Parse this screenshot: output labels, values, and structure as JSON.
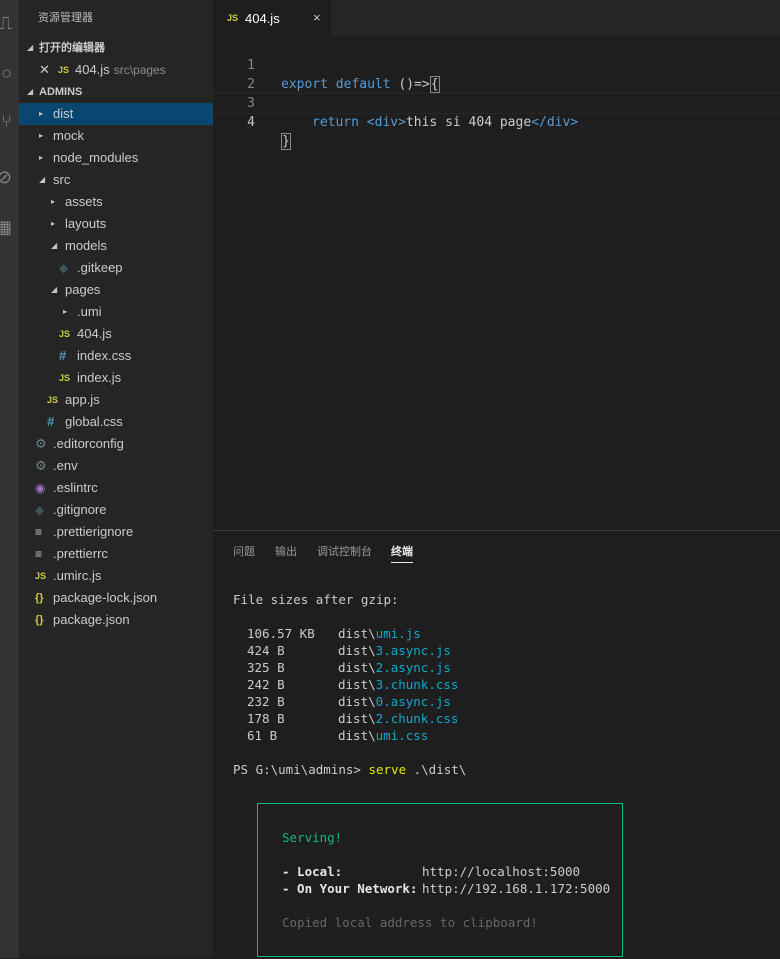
{
  "explorer": {
    "title": "资源管理器",
    "open_editors_label": "打开的编辑器",
    "open_editor": {
      "icon": "JS",
      "name": "404.js",
      "path": "src\\pages"
    },
    "project_label": "ADMINS",
    "tree": [
      {
        "label": "dist",
        "icon": "",
        "twisty": "▸",
        "selected": true
      },
      {
        "label": "mock",
        "icon": "",
        "twisty": "▸"
      },
      {
        "label": "node_modules",
        "icon": "",
        "twisty": "▸"
      },
      {
        "label": "src",
        "icon": "",
        "twisty": "◢"
      },
      {
        "label": "assets",
        "icon": "",
        "twisty": "▸"
      },
      {
        "label": "layouts",
        "icon": "",
        "twisty": "▸"
      },
      {
        "label": "models",
        "icon": "",
        "twisty": "◢"
      },
      {
        "label": ".gitkeep",
        "icon": "◆",
        "twisty": ""
      },
      {
        "label": "pages",
        "icon": "",
        "twisty": "◢"
      },
      {
        "label": ".umi",
        "icon": "",
        "twisty": "▸"
      },
      {
        "label": "404.js",
        "icon": "JS",
        "twisty": ""
      },
      {
        "label": "index.css",
        "icon": "#",
        "twisty": ""
      },
      {
        "label": "index.js",
        "icon": "JS",
        "twisty": ""
      },
      {
        "label": "app.js",
        "icon": "JS",
        "twisty": ""
      },
      {
        "label": "global.css",
        "icon": "#",
        "twisty": ""
      },
      {
        "label": ".editorconfig",
        "icon": "⚙",
        "twisty": ""
      },
      {
        "label": ".env",
        "icon": "⚙",
        "twisty": ""
      },
      {
        "label": ".eslintrc",
        "icon": "◉",
        "twisty": ""
      },
      {
        "label": ".gitignore",
        "icon": "◆",
        "twisty": ""
      },
      {
        "label": ".prettierignore",
        "icon": "≡",
        "twisty": ""
      },
      {
        "label": ".prettierrc",
        "icon": "≡",
        "twisty": ""
      },
      {
        "label": ".umirc.js",
        "icon": "JS",
        "twisty": ""
      },
      {
        "label": "package-lock.json",
        "icon": "{}",
        "twisty": ""
      },
      {
        "label": "package.json",
        "icon": "{}",
        "twisty": ""
      }
    ]
  },
  "editor": {
    "tab": {
      "icon": "JS",
      "name": "404.js",
      "close": "×"
    },
    "line_numbers": [
      "1",
      "2",
      "3",
      "4"
    ],
    "code": {
      "l1_kw": "export default",
      "l1_rest": " ()=>",
      "l1_brace": "{",
      "l3_kw": "return",
      "l3_open": "<div>",
      "l3_text": "this si 404 page",
      "l3_close": "</div>",
      "l4_brace": "}"
    }
  },
  "panel": {
    "tabs": [
      "问题",
      "输出",
      "调试控制台",
      "终端"
    ],
    "active_tab": "终端",
    "terminal": {
      "heading": "File sizes after gzip:",
      "files": [
        {
          "size": "106.57 KB",
          "dir": "dist\\",
          "file": "umi.js"
        },
        {
          "size": "424 B",
          "dir": "dist\\",
          "file": "3.async.js"
        },
        {
          "size": "325 B",
          "dir": "dist\\",
          "file": "2.async.js"
        },
        {
          "size": "242 B",
          "dir": "dist\\",
          "file": "3.chunk.css"
        },
        {
          "size": "232 B",
          "dir": "dist\\",
          "file": "0.async.js"
        },
        {
          "size": "178 B",
          "dir": "dist\\",
          "file": "2.chunk.css"
        },
        {
          "size": "61 B",
          "dir": "dist\\",
          "file": "umi.css"
        }
      ],
      "prompt": "PS G:\\umi\\admins> ",
      "command": "serve",
      "args": " .\\dist\\",
      "serving": "Serving!",
      "local_label": "- Local:",
      "local_url": "http://localhost:5000",
      "network_label": "- On Your Network:",
      "network_url": "http://192.168.1.172:5000",
      "copied": "Copied local address to clipboard!"
    }
  },
  "colors": {
    "js": "#cbcb41",
    "css": "#519aba",
    "selection": "#094771",
    "terminal_cyan": "#11a8cd",
    "terminal_green": "#0dbc79",
    "terminal_yellow": "#e5e510"
  },
  "icons": [
    "files-icon",
    "search-icon",
    "source-control-icon",
    "debug-icon",
    "extensions-icon"
  ]
}
